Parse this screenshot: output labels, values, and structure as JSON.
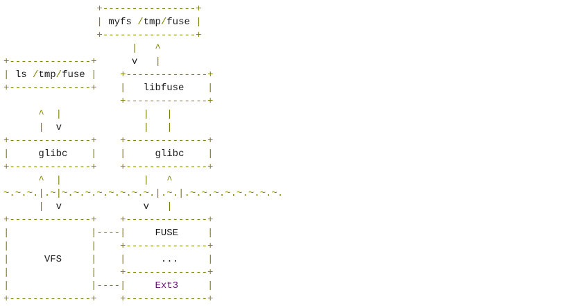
{
  "diagram": {
    "colors": {
      "operator": "#808000",
      "text": "#1a1a1a",
      "keyword": "#6a0a7a",
      "background": "#ffffff"
    },
    "lines": [
      [
        [
          "o",
          "                +----------------+"
        ]
      ],
      [
        [
          "o",
          "                | "
        ],
        [
          "t",
          "myfs "
        ],
        [
          "o",
          "/"
        ],
        [
          "t",
          "tmp"
        ],
        [
          "o",
          "/"
        ],
        [
          "t",
          "fuse"
        ],
        [
          "o",
          " |"
        ]
      ],
      [
        [
          "o",
          "                +----------------+"
        ]
      ],
      [
        [
          "o",
          "                      |   ^"
        ]
      ],
      [
        [
          "o",
          "+--------------+"
        ],
        [
          "t",
          "      v   "
        ],
        [
          "o",
          "|"
        ]
      ],
      [
        [
          "o",
          "| "
        ],
        [
          "t",
          "ls "
        ],
        [
          "o",
          "/"
        ],
        [
          "t",
          "tmp"
        ],
        [
          "o",
          "/"
        ],
        [
          "t",
          "fuse"
        ],
        [
          "o",
          " |"
        ],
        [
          "t",
          "    "
        ],
        [
          "o",
          "+--------------+"
        ]
      ],
      [
        [
          "o",
          "+--------------+    |   "
        ],
        [
          "t",
          "libfuse"
        ],
        [
          "o",
          "    |"
        ]
      ],
      [
        [
          "o",
          "                    +--------------+"
        ]
      ],
      [
        [
          "o",
          "      ^  |              |   |"
        ]
      ],
      [
        [
          "o",
          "      |  "
        ],
        [
          "t",
          "v"
        ],
        [
          "o",
          "              |   |"
        ]
      ],
      [
        [
          "o",
          "+--------------+    +--------------+"
        ]
      ],
      [
        [
          "o",
          "|     "
        ],
        [
          "t",
          "glibc"
        ],
        [
          "o",
          "    |    |     "
        ],
        [
          "t",
          "glibc"
        ],
        [
          "o",
          "    |"
        ]
      ],
      [
        [
          "o",
          "+--------------+    +--------------+"
        ]
      ],
      [
        [
          "o",
          "      ^  |              |   ^"
        ]
      ],
      [
        [
          "o",
          "~.~.~.|.~|~.~.~.~.~.~.~.~.|.~.|.~.~.~.~.~.~.~.~."
        ]
      ],
      [
        [
          "o",
          "      |  "
        ],
        [
          "t",
          "v"
        ],
        [
          "o",
          "              "
        ],
        [
          "t",
          "v"
        ],
        [
          "o",
          "   |"
        ]
      ],
      [
        [
          "o",
          "+--------------+    +--------------+"
        ]
      ],
      [
        [
          "o",
          "|              |----|     "
        ],
        [
          "t",
          "FUSE"
        ],
        [
          "o",
          "     |"
        ]
      ],
      [
        [
          "o",
          "|              |    +--------------+"
        ]
      ],
      [
        [
          "o",
          "|      "
        ],
        [
          "t",
          "VFS"
        ],
        [
          "o",
          "     |    |      "
        ],
        [
          "t",
          "..."
        ],
        [
          "o",
          "     |"
        ]
      ],
      [
        [
          "o",
          "|              |    +--------------+"
        ]
      ],
      [
        [
          "o",
          "|              |----|     "
        ],
        [
          "k",
          "Ext3"
        ],
        [
          "o",
          "     |"
        ]
      ],
      [
        [
          "o",
          "+--------------+    +--------------+"
        ]
      ]
    ]
  }
}
